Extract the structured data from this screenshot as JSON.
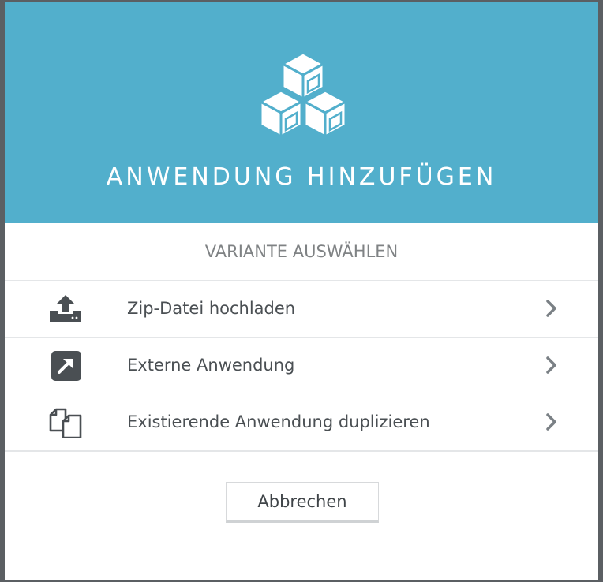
{
  "header": {
    "title": "ANWENDUNG HINZUFÜGEN",
    "icon": "cubes-icon",
    "background_color": "#52afcc"
  },
  "subtitle": "VARIANTE AUSWÄHLEN",
  "options": [
    {
      "label": "Zip-Datei hochladen",
      "icon": "upload-icon"
    },
    {
      "label": "Externe Anwendung",
      "icon": "external-link-icon"
    },
    {
      "label": "Existierende Anwendung duplizieren",
      "icon": "duplicate-icon"
    }
  ],
  "cancel_label": "Abbrechen"
}
